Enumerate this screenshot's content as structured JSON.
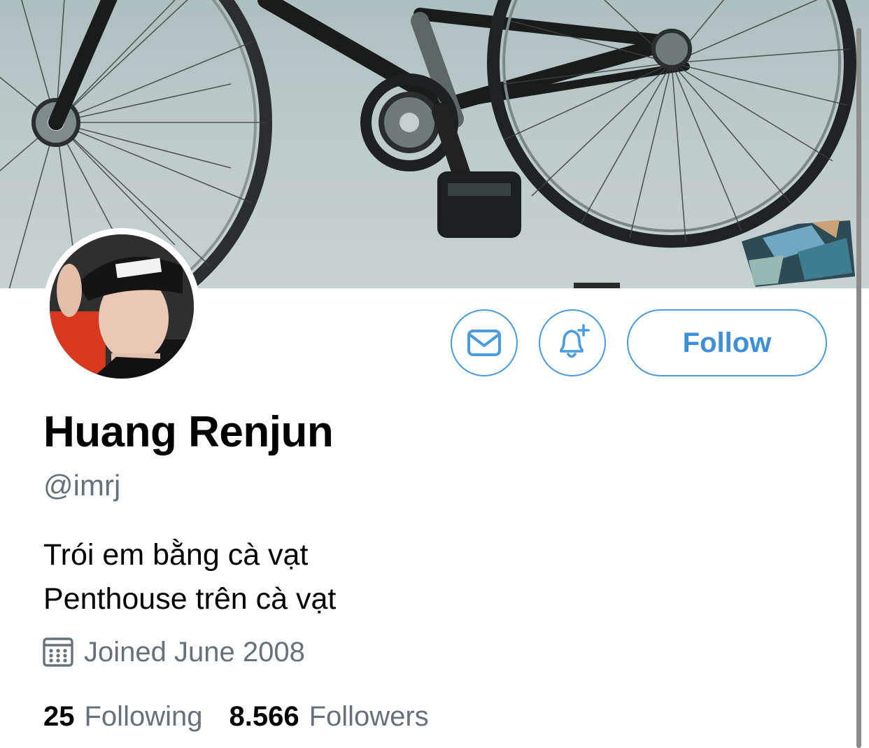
{
  "profile": {
    "name": "Huang Renjun",
    "handle": "@imrj",
    "bio_lines": [
      "Trói em bằng cà vạt",
      "Penthouse trên cà vạt"
    ],
    "joined": "Joined June 2008",
    "following_count": "25",
    "following_label": "Following",
    "followers_count": "8.566",
    "followers_label": "Followers"
  },
  "actions": {
    "message_icon": "envelope-icon",
    "notify_icon": "bell-plus-icon",
    "follow_label": "Follow"
  },
  "icons": {
    "joined_icon": "calendar-icon"
  },
  "colors": {
    "accent": "#4a9be0",
    "secondary_text": "#67717b",
    "primary_text": "#000000"
  }
}
